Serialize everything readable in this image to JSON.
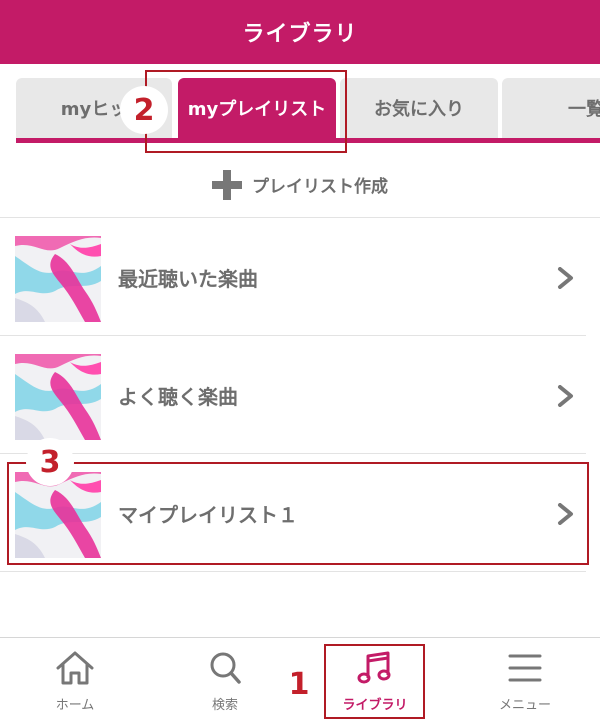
{
  "header": {
    "title": "ライブラリ"
  },
  "tabs": [
    {
      "label": "myヒッ",
      "active": false
    },
    {
      "label": "myプレイリスト",
      "active": true
    },
    {
      "label": "お気に入り",
      "active": false
    },
    {
      "label": "一覧",
      "active": false
    }
  ],
  "create_playlist": {
    "label": "プレイリスト作成",
    "icon": "plus-icon"
  },
  "playlists": [
    {
      "title": "最近聴いた楽曲",
      "icon": "chevron-right-icon"
    },
    {
      "title": "よく聴く楽曲",
      "icon": "chevron-right-icon"
    },
    {
      "title": "マイプレイリスト１",
      "icon": "chevron-right-icon"
    }
  ],
  "annotations": {
    "step1": "1",
    "step2": "2",
    "step3": "3",
    "color": "#b01a24"
  },
  "bottom_nav": [
    {
      "label": "ホーム",
      "icon": "home-icon",
      "active": false
    },
    {
      "label": "検索",
      "icon": "search-icon",
      "active": false
    },
    {
      "label": "ライブラリ",
      "icon": "music-note-icon",
      "active": true
    },
    {
      "label": "メニュー",
      "icon": "menu-icon",
      "active": false
    }
  ],
  "colors": {
    "brand": "#c31b67",
    "text": "#6e6e6e",
    "tab_bg": "#e8e8e8"
  }
}
